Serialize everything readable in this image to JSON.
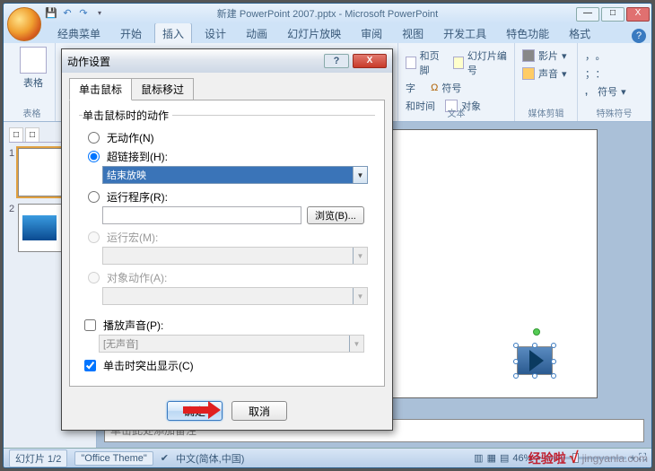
{
  "window": {
    "title": "新建 PowerPoint 2007.pptx - Microsoft PowerPoint",
    "min": "—",
    "max": "□",
    "close": "X"
  },
  "tabs": {
    "items": [
      "经典菜单",
      "开始",
      "插入",
      "设计",
      "动画",
      "幻灯片放映",
      "审阅",
      "视图",
      "开发工具",
      "特色功能",
      "格式"
    ],
    "active": 2
  },
  "ribbon": {
    "group_table": "表格",
    "btn_table": "表格",
    "group_text": "文本",
    "group_media": "媒体剪辑",
    "group_symbol": "特殊符号",
    "hdrfoot": "和页脚",
    "slidenum": "幻灯片编号",
    "char": "字",
    "symbol": "符号",
    "datetime": "和时间",
    "object": "对象",
    "movie": "影片",
    "sound": "声音",
    "sym1": "，。",
    "sym2": "；：",
    "sym_more": "符号"
  },
  "slidepanel": {
    "tab_a": "□",
    "tab_b": "□",
    "close": "x",
    "n1": "1",
    "n2": "2"
  },
  "notes": "单击此处添加备注",
  "status": {
    "slide": "幻灯片 1/2",
    "theme": "\"Office Theme\"",
    "lang": "中文(简体,中国)",
    "zoom": "46%"
  },
  "dialog": {
    "title": "动作设置",
    "help": "?",
    "close": "X",
    "tab_click": "单击鼠标",
    "tab_hover": "鼠标移过",
    "legend": "单击鼠标时的动作",
    "opt_none": "无动作(N)",
    "opt_link": "超链接到(H):",
    "link_value": "结束放映",
    "opt_run": "运行程序(R):",
    "browse": "浏览(B)...",
    "opt_macro": "运行宏(M):",
    "opt_ole": "对象动作(A):",
    "chk_sound": "播放声音(P):",
    "sound_value": "[无声音]",
    "chk_highlight": "单击时突出显示(C)",
    "ok": "确定",
    "cancel": "取消"
  },
  "watermark": {
    "brand": "经验啦",
    "check": "√",
    "url": "jingyanla.com"
  }
}
